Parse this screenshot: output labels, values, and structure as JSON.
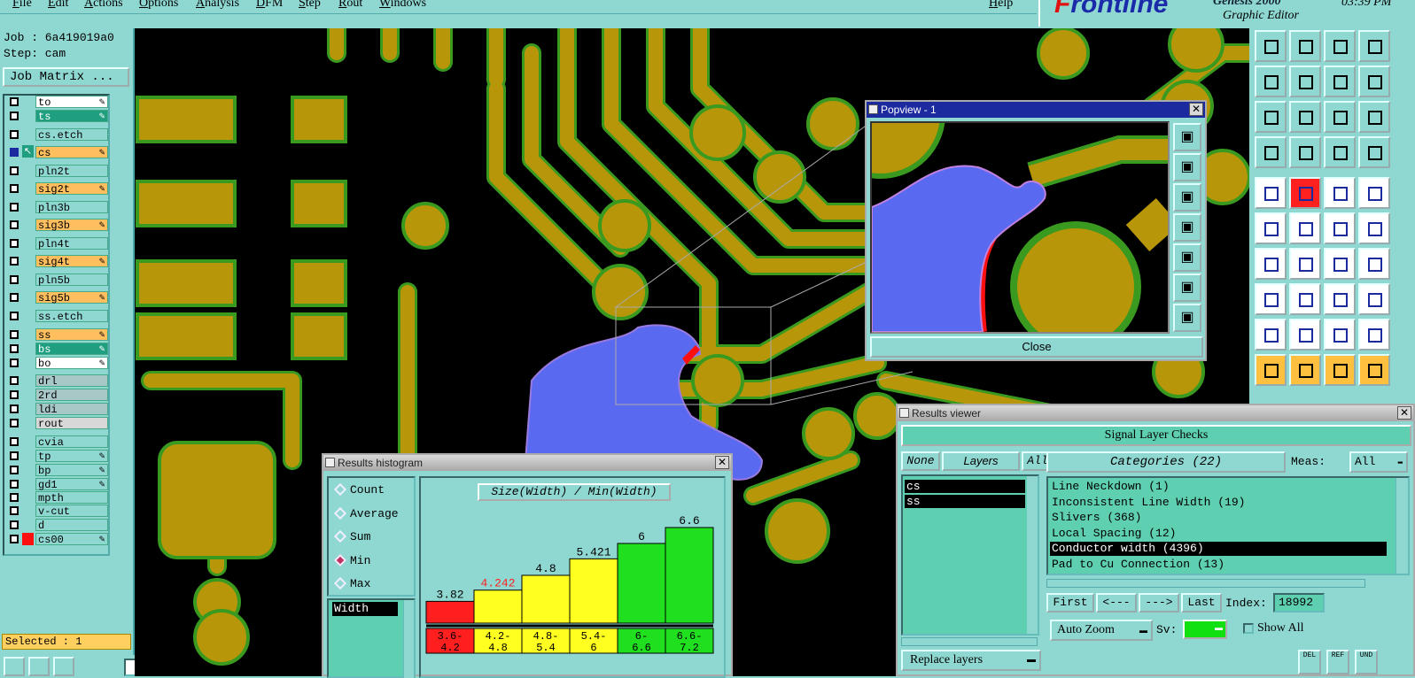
{
  "menu": [
    "File",
    "Edit",
    "Actions",
    "Options",
    "Analysis",
    "DFM",
    "Step",
    "Rout",
    "Windows"
  ],
  "help": "Help",
  "logo": {
    "brand_f": "F",
    "brand_rest": "rontline",
    "product": "Genesis 2000",
    "subtitle": "Graphic Editor",
    "time": "03:39 PM"
  },
  "job": {
    "job_label": "Job : 6a419019a0",
    "step_label": "Step: cam",
    "matrix_button": "Job Matrix ..."
  },
  "layers": [
    {
      "name": "to",
      "color": "#ffffff",
      "pen": true
    },
    {
      "name": "ts",
      "color": "#1f9f7f",
      "pen": true
    },
    {
      "name": "cs.etch",
      "color": "#8fd8d2",
      "pen": false
    },
    {
      "name": "cs",
      "color": "#ffbf5f",
      "pen": true,
      "work": true
    },
    {
      "name": "pln2t",
      "color": "#8fd8d2",
      "pen": false
    },
    {
      "name": "sig2t",
      "color": "#ffbf5f",
      "pen": true
    },
    {
      "name": "pln3b",
      "color": "#8fd8d2",
      "pen": false
    },
    {
      "name": "sig3b",
      "color": "#ffbf5f",
      "pen": true
    },
    {
      "name": "pln4t",
      "color": "#8fd8d2",
      "pen": false
    },
    {
      "name": "sig4t",
      "color": "#ffbf5f",
      "pen": true
    },
    {
      "name": "pln5b",
      "color": "#8fd8d2",
      "pen": false
    },
    {
      "name": "sig5b",
      "color": "#ffbf5f",
      "pen": true
    },
    {
      "name": "ss.etch",
      "color": "#8fd8d2",
      "pen": false
    },
    {
      "name": "ss",
      "color": "#ffbf5f",
      "pen": true
    },
    {
      "name": "bs",
      "color": "#1f9f7f",
      "pen": true
    },
    {
      "name": "bo",
      "color": "#ffffff",
      "pen": true
    },
    {
      "name": "drl",
      "color": "#a8c8c8",
      "pen": false
    },
    {
      "name": "2rd",
      "color": "#a8c8c8",
      "pen": false
    },
    {
      "name": "ldi",
      "color": "#a8c8c8",
      "pen": false
    },
    {
      "name": "rout",
      "color": "#d8d8d8",
      "pen": false
    },
    {
      "name": "cvia",
      "color": "#8fd8d2",
      "pen": false
    },
    {
      "name": "tp",
      "color": "#8fd8d2",
      "pen": true
    },
    {
      "name": "bp",
      "color": "#8fd8d2",
      "pen": true
    },
    {
      "name": "gd1",
      "color": "#8fd8d2",
      "pen": true
    },
    {
      "name": "mpth",
      "color": "#8fd8d2",
      "pen": false
    },
    {
      "name": "v-cut",
      "color": "#8fd8d2",
      "pen": false
    },
    {
      "name": "d",
      "color": "#8fd8d2",
      "pen": false
    },
    {
      "name": "cs00",
      "color": "#8fd8d2",
      "pen": true,
      "red": true
    }
  ],
  "selected": "Selected : 1",
  "popview": {
    "title": "Popview - 1",
    "close": "Close"
  },
  "histogram": {
    "title": "Results histogram",
    "modes": [
      "Count",
      "Average",
      "Sum",
      "Min",
      "Max"
    ],
    "selected_mode": "Min",
    "field": "Width",
    "chart_title": "Size(Width) / Min(Width)"
  },
  "chart_data": {
    "type": "bar",
    "title": "Size(Width) / Min(Width)",
    "categories": [
      "3.6-4.2",
      "4.2-4.8",
      "4.8-5.4",
      "5.4-6",
      "6-6.6",
      "6.6-7.2"
    ],
    "values": [
      3.82,
      4.242,
      4.8,
      5.421,
      6,
      6.6
    ],
    "value_labels": [
      "3.82",
      "4.242",
      "4.8",
      "5.421",
      "6",
      "6.6"
    ],
    "cat_lines": [
      [
        "3.6-",
        "4.2"
      ],
      [
        "4.2-",
        "4.8"
      ],
      [
        "4.8-",
        "5.4"
      ],
      [
        "5.4-",
        "6"
      ],
      [
        "6-",
        "6.6"
      ],
      [
        "6.6-",
        "7.2"
      ]
    ],
    "colors": [
      "#ff1f1f",
      "#ffff20",
      "#ffff20",
      "#ffff20",
      "#1fdf1f",
      "#1fdf1f"
    ],
    "label_colors": [
      "#000000",
      "#ff1f1f",
      "#000000",
      "#000000",
      "#000000",
      "#000000"
    ],
    "ylim": [
      3,
      7
    ]
  },
  "results": {
    "title": "Results viewer",
    "header": "Signal Layer Checks",
    "none": "None",
    "layers": "Layers",
    "all": "All",
    "layer_list": [
      "cs",
      "ss"
    ],
    "categories_label": "Categories (22)",
    "meas_label": "Meas:",
    "meas_value": "All",
    "categories": [
      "Line Neckdown (1)",
      "Inconsistent Line Width (19)",
      "Slivers (368)",
      "Local Spacing (12)",
      "Conductor width (4396)",
      "Pad to Cu Connection (13)"
    ],
    "selected_category": "Conductor width (4396)",
    "first": "First",
    "prev": "<---",
    "next": "--->",
    "last": "Last",
    "index_label": "Index:",
    "index_value": "18992",
    "auto_zoom": "Auto Zoom",
    "sv_label": "Sv:",
    "show_all": "Show All",
    "replace_layers": "Replace layers",
    "del": "DEL",
    "ref": "REF",
    "und": "UND"
  },
  "colors": {
    "copper": "#b8960a",
    "pad_rim": "#3a9a20",
    "highlight": "#5a6af0",
    "defect": "#ff1010",
    "panel": "#8fd8d2"
  }
}
